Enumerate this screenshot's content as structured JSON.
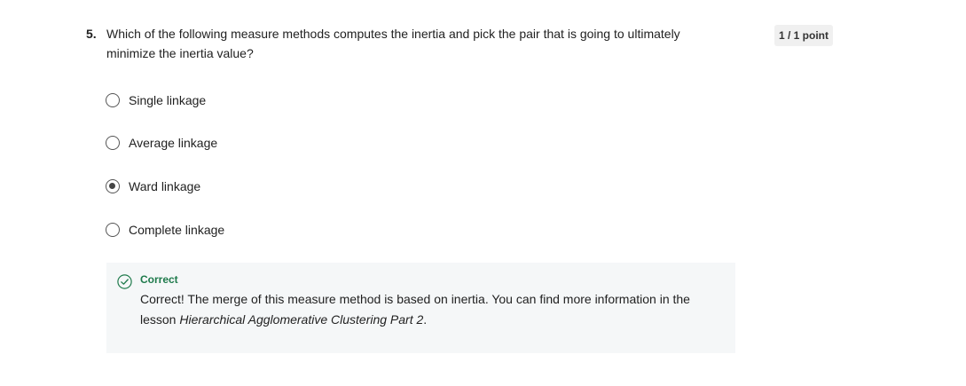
{
  "question": {
    "number": "5.",
    "text": "Which of the following measure methods computes the inertia and pick the pair that is going to ultimately minimize the inertia value?",
    "points": "1 / 1 point"
  },
  "options": [
    {
      "label": "Single linkage",
      "selected": false
    },
    {
      "label": "Average linkage",
      "selected": false
    },
    {
      "label": "Ward linkage",
      "selected": true
    },
    {
      "label": "Complete linkage",
      "selected": false
    }
  ],
  "feedback": {
    "status": "Correct",
    "text_prefix": "Correct! The merge of this measure method is based on inertia. You can find more information in the lesson ",
    "lesson_title": "Hierarchical Agglomerative Clustering Part 2",
    "text_suffix": ".",
    "status_color": "#1e7a4b"
  }
}
